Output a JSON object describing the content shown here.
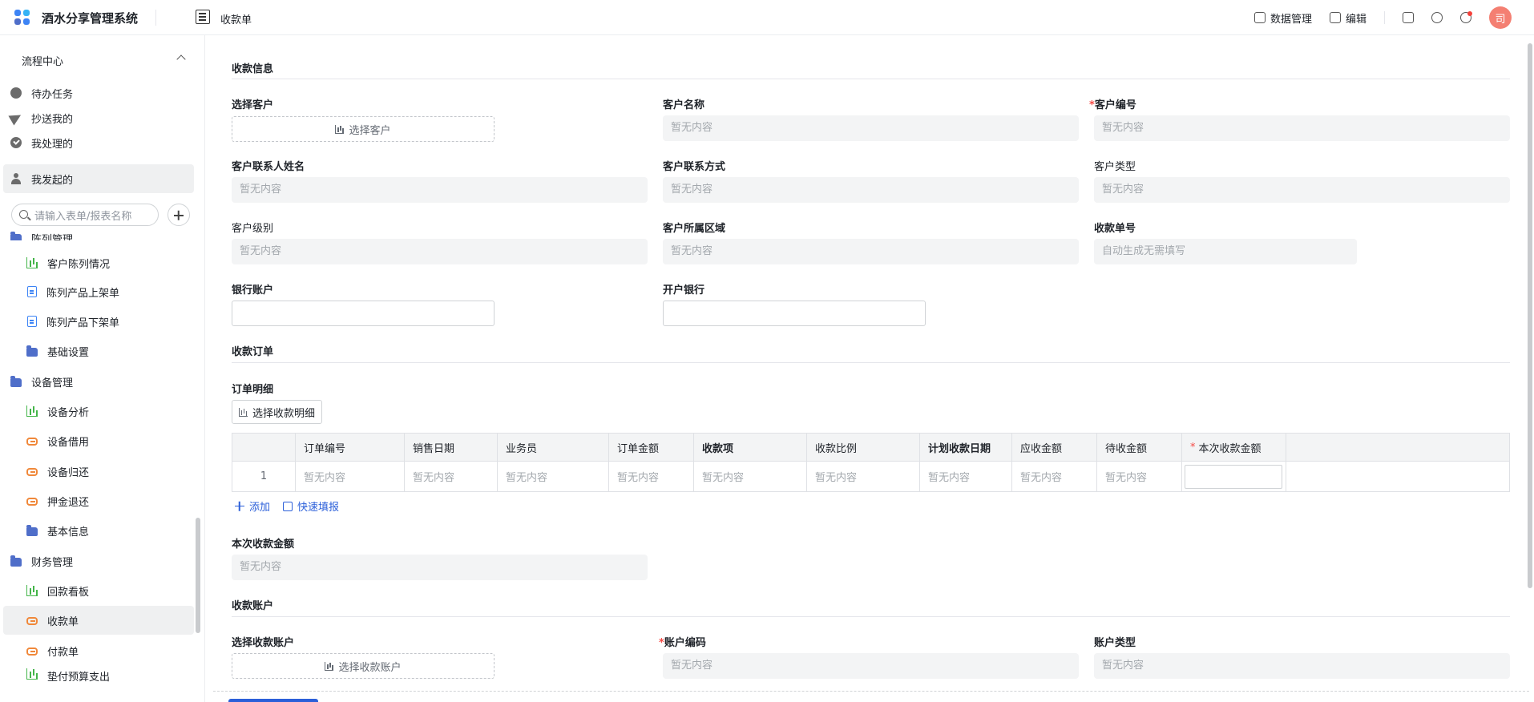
{
  "app": {
    "title": "酒水分享管理系统",
    "breadcrumb": "收款单"
  },
  "topbar": {
    "data_manage": "数据管理",
    "edit": "编辑",
    "avatar_text": "司"
  },
  "sidebar": {
    "section_label": "流程中心",
    "flow_items": [
      {
        "label": "待办任务",
        "icon": "circle-task-icon"
      },
      {
        "label": "抄送我的",
        "icon": "send-icon"
      },
      {
        "label": "我处理的",
        "icon": "check-circle-icon"
      },
      {
        "label": "我发起的",
        "icon": "user-icon"
      }
    ],
    "search_placeholder": "请输入表单/报表名称",
    "partial_group": "陈列管理",
    "items": [
      {
        "label": "客户陈列情况"
      },
      {
        "label": "陈列产品上架单"
      },
      {
        "label": "陈列产品下架单"
      },
      {
        "label": "基础设置"
      },
      {
        "label": "设备管理"
      },
      {
        "label": "设备分析"
      },
      {
        "label": "设备借用"
      },
      {
        "label": "设备归还"
      },
      {
        "label": "押金退还"
      },
      {
        "label": "基本信息"
      },
      {
        "label": "财务管理"
      },
      {
        "label": "回款看板"
      },
      {
        "label": "收款单"
      },
      {
        "label": "付款单"
      },
      {
        "label": "垫付预算支出"
      }
    ]
  },
  "form": {
    "placeholder": "暂无内容",
    "sec_info": "收款信息",
    "select_customer_label": "选择客户",
    "select_customer_btn": "选择客户",
    "customer_name": "客户名称",
    "customer_no": "客户编号",
    "contact_name": "客户联系人姓名",
    "contact_way": "客户联系方式",
    "customer_type": "客户类型",
    "customer_level": "客户级别",
    "customer_region": "客户所属区域",
    "receipt_no": "收款单号",
    "receipt_no_placeholder": "自动生成无需填写",
    "bank_account": "银行账户",
    "bank_name": "开户银行",
    "sec_order": "收款订单",
    "order_detail": "订单明细",
    "select_detail_btn": "选择收款明细",
    "columns": [
      "订单编号",
      "销售日期",
      "业务员",
      "订单金额",
      "收款项",
      "收款比例",
      "计划收款日期",
      "应收金额",
      "待收金额",
      "本次收款金额"
    ],
    "row_index": "1",
    "add_label": "添加",
    "quick_fill_label": "快速填报",
    "this_amount": "本次收款金额",
    "sec_account": "收款账户",
    "select_account_label": "选择收款账户",
    "select_account_btn": "选择收款账户",
    "account_code": "账户编码",
    "account_type": "账户类型",
    "required_mark": "*"
  }
}
